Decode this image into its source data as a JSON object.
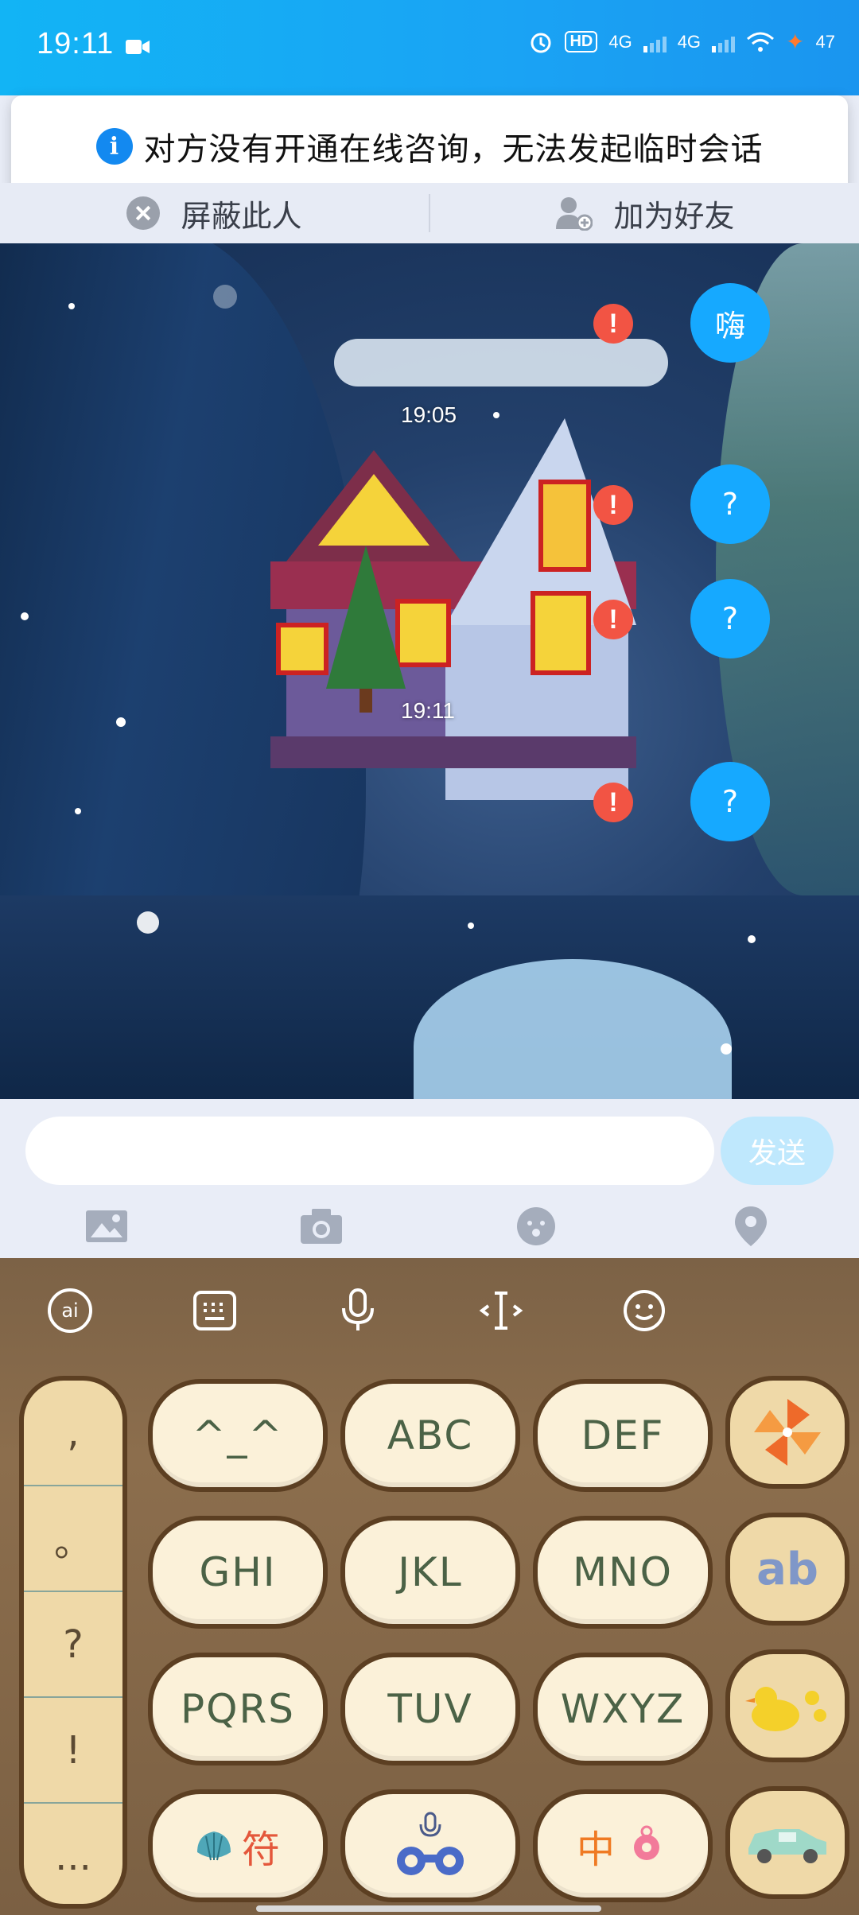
{
  "status_bar": {
    "time": "19:11",
    "hd": "HD",
    "net1": "4G",
    "net2": "4G",
    "battery": "47"
  },
  "toast": {
    "text": "对方没有开通在线咨询，无法发起临时会话",
    "icon": "info-icon"
  },
  "actions": {
    "block": "屏蔽此人",
    "add_friend": "加为好友"
  },
  "chat": {
    "timestamps": [
      "19:05",
      "19:11"
    ],
    "messages": [
      {
        "text": "嗨",
        "status": "error"
      },
      {
        "text": "?",
        "status": "error"
      },
      {
        "text": "?",
        "status": "error"
      },
      {
        "text": "?",
        "status": "error"
      }
    ]
  },
  "input": {
    "value": "",
    "send_label": "发送",
    "tools": [
      "image-icon",
      "camera-icon",
      "emoji-icon",
      "location-icon"
    ]
  },
  "keyboard": {
    "top_icons": [
      "ime-logo-icon",
      "keyboard-icon",
      "microphone-icon",
      "cursor-icon",
      "emoji-icon"
    ],
    "punctuation": [
      ",",
      "。",
      "?",
      "!",
      "..."
    ],
    "keys": [
      [
        "^_^",
        "ABC",
        "DEF"
      ],
      [
        "GHI",
        "JKL",
        "MNO"
      ],
      [
        "PQRS",
        "TUV",
        "WXYZ"
      ]
    ],
    "side_keys": [
      "pinwheel-icon",
      "ab",
      "duck-icon",
      "car-icon"
    ],
    "bottom": {
      "symbols": "符",
      "chinese": "中"
    }
  },
  "colors": {
    "status_bar": "#12b4f5",
    "bubble": "#16a9ff",
    "error": "#f25444",
    "send_disabled": "#bfe8fd",
    "key_face": "#fbf1d9",
    "key_border": "#5c3f22"
  }
}
